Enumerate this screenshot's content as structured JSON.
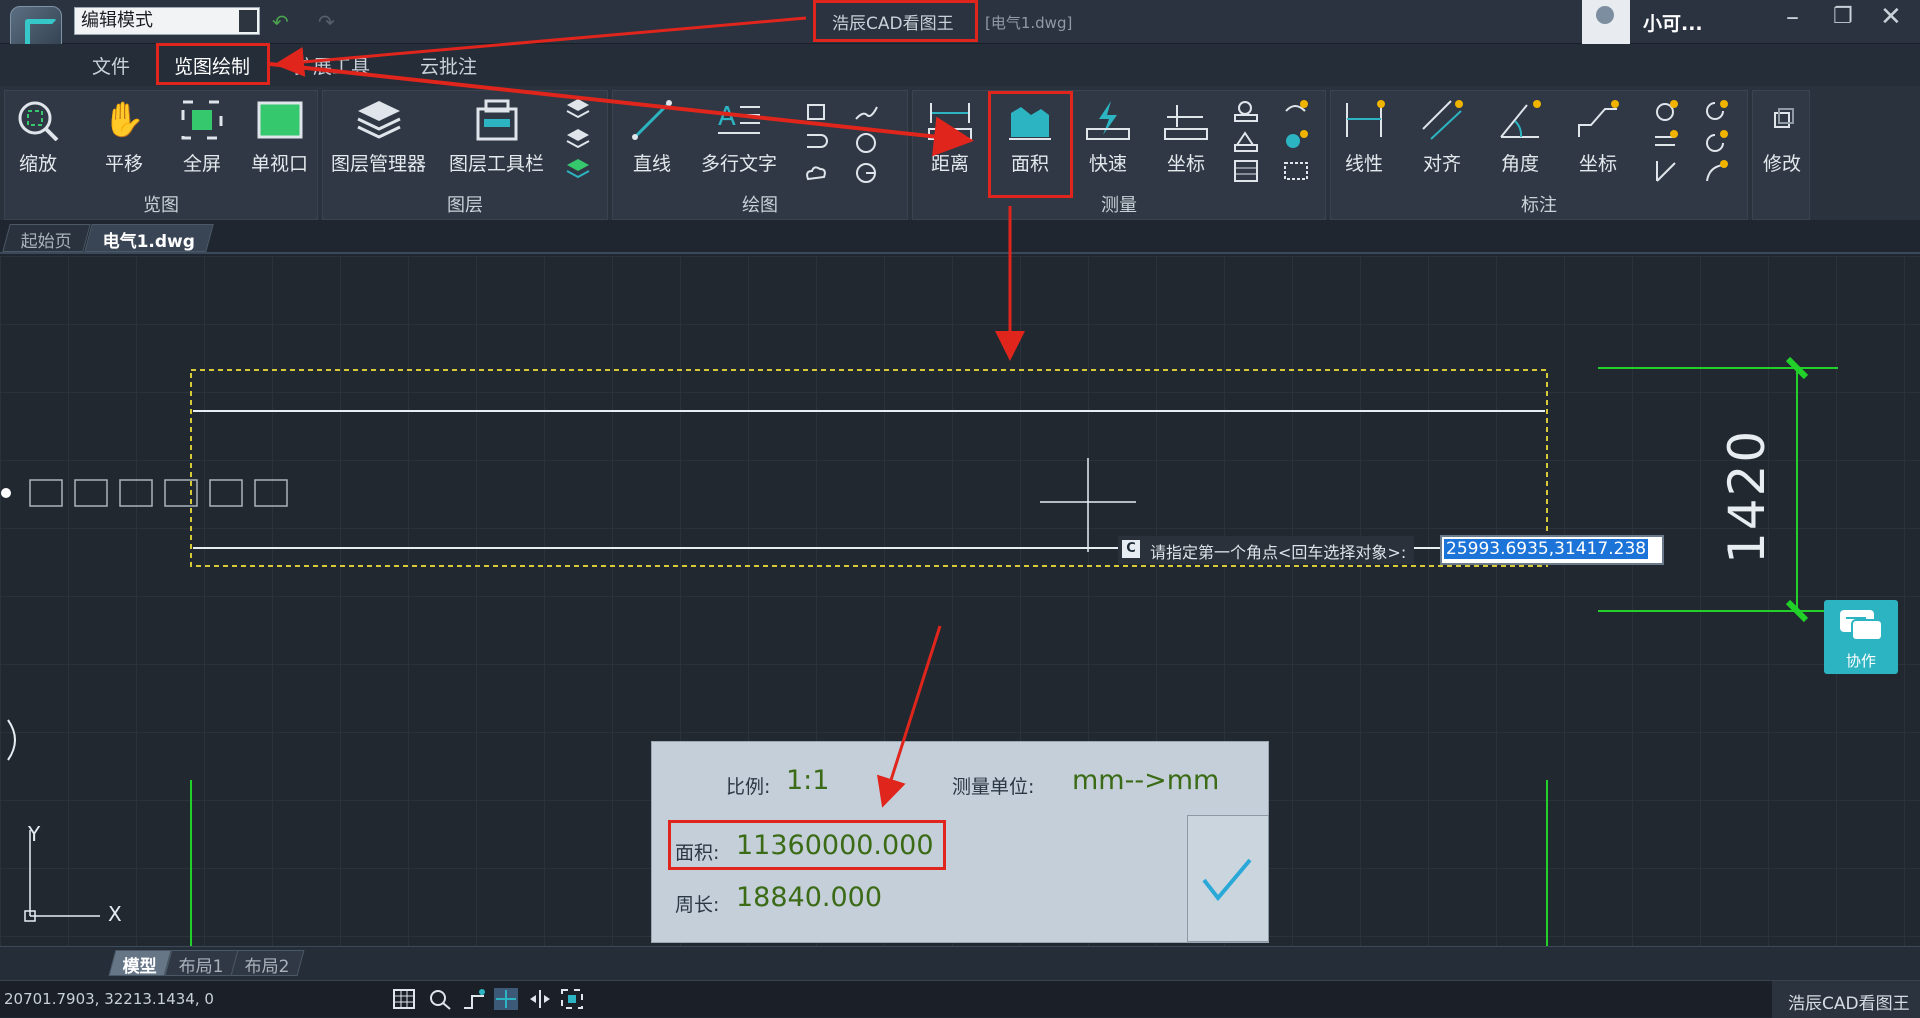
{
  "titlebar": {
    "mode": "编辑模式",
    "app_title": "浩辰CAD看图王",
    "file_title": "[电气1.dwg]",
    "user_name": "小可..."
  },
  "menu": [
    "文件",
    "览图绘制",
    "扩展工具",
    "云批注"
  ],
  "ribbon": {
    "groups": [
      {
        "label": "览图",
        "buttons": [
          "缩放",
          "平移",
          "全屏",
          "单视口"
        ]
      },
      {
        "label": "图层",
        "buttons": [
          "图层管理器",
          "图层工具栏"
        ]
      },
      {
        "label": "绘图",
        "buttons": [
          "直线",
          "多行文字"
        ]
      },
      {
        "label": "测量",
        "buttons": [
          "距离",
          "面积",
          "快速",
          "坐标"
        ]
      },
      {
        "label": "标注",
        "buttons": [
          "线性",
          "对齐",
          "角度",
          "坐标"
        ]
      },
      {
        "label": "",
        "buttons": [
          "修改"
        ]
      }
    ]
  },
  "doc_tabs": [
    "起始页",
    "电气1.dwg"
  ],
  "canvas": {
    "dimension_text": "1420",
    "command_prompt": "请指定第一个角点<回车选择对象>:",
    "command_value": "25993.6935,31417.238",
    "axis_x": "X",
    "axis_y": "Y"
  },
  "measure_panel": {
    "scale_label": "比例:",
    "scale_value": "1:1",
    "unit_label": "测量单位:",
    "unit_value": "mm-->mm",
    "area_label": "面积:",
    "area_value": "11360000.000",
    "perimeter_label": "周长:",
    "perimeter_value": "18840.000"
  },
  "collab_label": "协作",
  "layout_tabs": [
    "模型",
    "布局1",
    "布局2"
  ],
  "status": {
    "coords": "20701.7903, 32213.1434, 0",
    "brand": "浩辰CAD看图王"
  },
  "colors": {
    "annotation_red": "#e0251c",
    "accent_teal": "#2db4c2",
    "value_green": "#3b6b16"
  }
}
